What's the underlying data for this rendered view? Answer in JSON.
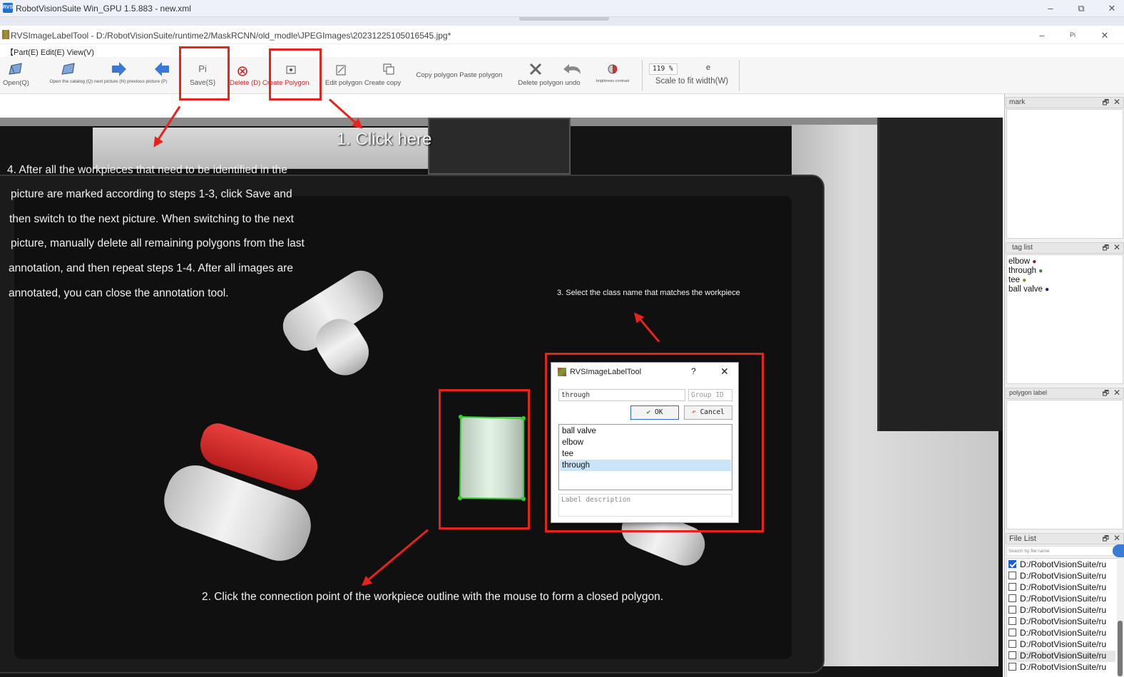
{
  "window": {
    "title": "RobotVisionSuite Win_GPU 1.5.883 - new.xml",
    "logo": "RVS",
    "minimize": "–",
    "restore": "⧉",
    "close": "✕"
  },
  "labeltool": {
    "title": "RVSImageLabelTool - D:/RobotVisionSuite/runtime2/MaskRCNN/old_modle\\JPEGImages\\20231225105016545.jpg*",
    "minimize": "–",
    "pin": "Pi",
    "close": "✕"
  },
  "menu": {
    "label": "【Part(E) Edit(E) View(V)"
  },
  "toolbar": {
    "open": "Open(Q)",
    "open_catalog": "Open the catalog (Q) next picture (N) previous picture (P)",
    "save_icon": "Pi",
    "save": "Save(S)",
    "delete_create": "Delete (D) Create Polygon",
    "edit_copy": "Edit polygon Create copy",
    "copy_paste": "Copy polygon Paste polygon",
    "delete_undo": "Delete polygon undo",
    "brightness": "brightness contrast",
    "zoom": "119 %",
    "zoom_e": "e",
    "scale_fit": "Scale to fit width(W)"
  },
  "instructions": {
    "step1": "1. Click here",
    "step4_lines": [
      "4. After all the workpieces that need to be identified in the",
      "picture are marked according to steps 1-3, click Save and",
      "then switch to the next picture. When switching to the next",
      "picture, manually delete all remaining polygons from the last",
      "annotation, and then repeat steps 1-4. After all images are",
      "annotated, you can close the annotation tool."
    ],
    "step3": "3. Select the class name that matches the workpiece",
    "step2": "2. Click the connection point of the workpiece outline with the mouse to form a closed polygon."
  },
  "dialog": {
    "title": "RVSImageLabelTool",
    "help": "?",
    "close": "✕",
    "label_value": "through",
    "group_placeholder": "Group ID",
    "ok": "OK",
    "cancel": "Cancel",
    "items": [
      "ball valve",
      "elbow",
      "tee",
      "through"
    ],
    "selected_index": 3,
    "description_placeholder": "Label description"
  },
  "sidebar": {
    "mark_title": "mark",
    "tag_list_title": "tag list",
    "tags": [
      {
        "name": "elbow",
        "color": "#8b1a1a"
      },
      {
        "name": "through",
        "color": "#2e8b2e"
      },
      {
        "name": "tee",
        "color": "#8a8a1e"
      },
      {
        "name": "ball valve",
        "color": "#1a1a8b"
      }
    ],
    "polygon_label_title": "polygon label",
    "file_list_title": "File List",
    "search_placeholder": "Search by file name",
    "files": [
      {
        "path": "D:/RobotVisionSuite/ru",
        "checked": true
      },
      {
        "path": "D:/RobotVisionSuite/ru",
        "checked": false
      },
      {
        "path": "D:/RobotVisionSuite/ru",
        "checked": false
      },
      {
        "path": "D:/RobotVisionSuite/ru",
        "checked": false
      },
      {
        "path": "D:/RobotVisionSuite/ru",
        "checked": false
      },
      {
        "path": "D:/RobotVisionSuite/ru",
        "checked": false
      },
      {
        "path": "D:/RobotVisionSuite/ru",
        "checked": false
      },
      {
        "path": "D:/RobotVisionSuite/ru",
        "checked": false
      },
      {
        "path": "D:/RobotVisionSuite/ru",
        "checked": false
      },
      {
        "path": "D:/RobotVisionSuite/ru",
        "checked": false
      }
    ],
    "dock_float": "🗗",
    "dock_close": "✕"
  }
}
